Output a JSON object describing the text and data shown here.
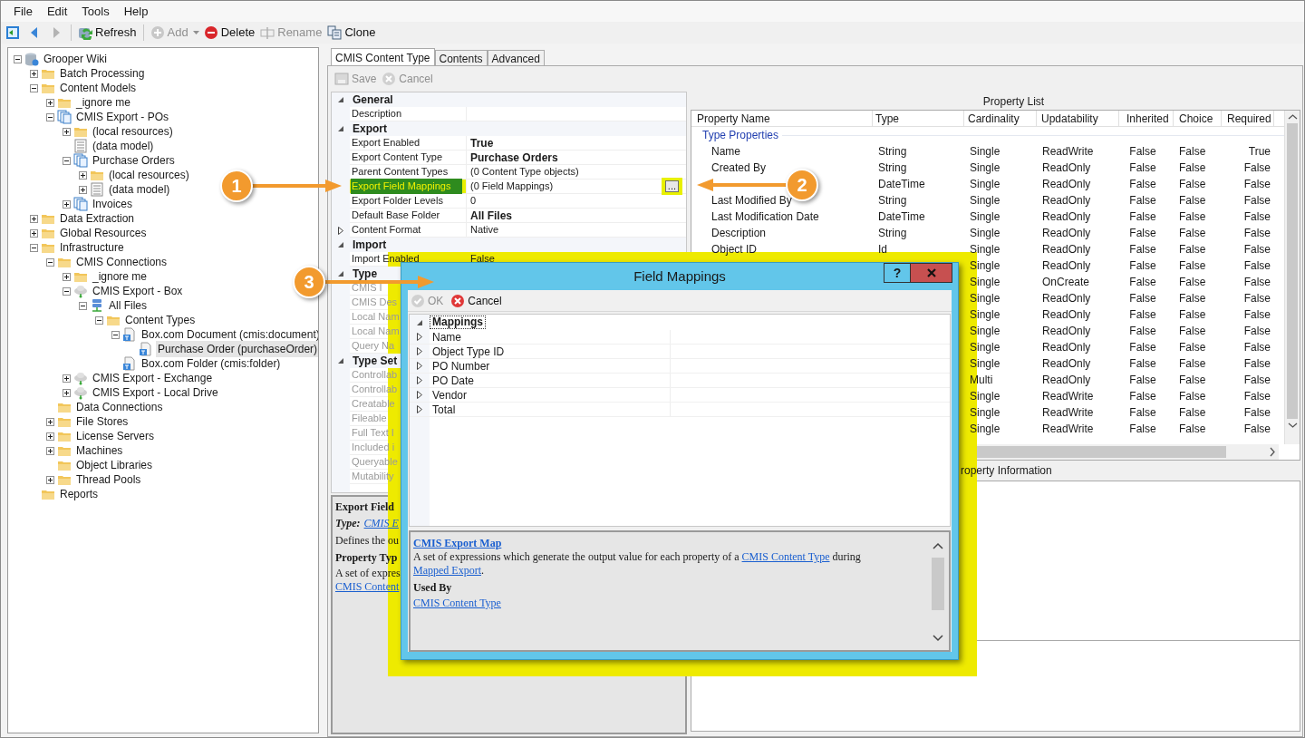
{
  "menu": [
    "File",
    "Edit",
    "Tools",
    "Help"
  ],
  "nav": [
    {
      "kind": "home",
      "disabled": false
    },
    {
      "kind": "back",
      "disabled": false
    },
    {
      "kind": "forward",
      "disabled": true
    }
  ],
  "toolbar": [
    {
      "kind": "refresh",
      "label": "Refresh",
      "disabled": false
    },
    {
      "kind": "add",
      "label": "Add",
      "disabled": true,
      "dropdown": true
    },
    {
      "kind": "delete",
      "label": "Delete",
      "disabled": false
    },
    {
      "kind": "rename",
      "label": "Rename",
      "disabled": true
    },
    {
      "kind": "clone",
      "label": "Clone",
      "disabled": false
    }
  ],
  "tree": [
    {
      "label": "Grooper Wiki",
      "kind": "database",
      "expanded": true,
      "selected": false,
      "children": [
        {
          "label": "Batch Processing",
          "kind": "folder",
          "expanded": false,
          "selected": false
        },
        {
          "label": "Content Models",
          "kind": "folder",
          "expanded": true,
          "selected": false,
          "children": [
            {
              "label": "_ignore me",
              "kind": "folder",
              "expanded": false,
              "selected": false
            },
            {
              "label": "CMIS Export - POs",
              "kind": "docs",
              "expanded": true,
              "selected": false,
              "children": [
                {
                  "label": "(local resources)",
                  "kind": "folder",
                  "expanded": false,
                  "selected": false
                },
                {
                  "label": "(data model)",
                  "kind": "datamodel",
                  "selected": false
                },
                {
                  "label": "Purchase Orders",
                  "kind": "docs",
                  "expanded": true,
                  "selected": false,
                  "children": [
                    {
                      "label": "(local resources)",
                      "kind": "folder",
                      "expanded": false,
                      "selected": false
                    },
                    {
                      "label": "(data model)",
                      "kind": "datamodel",
                      "expanded": false,
                      "selected": false
                    }
                  ]
                },
                {
                  "label": "Invoices",
                  "kind": "docs",
                  "expanded": false,
                  "selected": false
                }
              ]
            }
          ]
        },
        {
          "label": "Data Extraction",
          "kind": "folder",
          "expanded": false,
          "selected": false
        },
        {
          "label": "Global Resources",
          "kind": "folder",
          "expanded": false,
          "selected": false
        },
        {
          "label": "Infrastructure",
          "kind": "folder",
          "expanded": true,
          "selected": false,
          "children": [
            {
              "label": "CMIS Connections",
              "kind": "folder",
              "expanded": true,
              "selected": false,
              "children": [
                {
                  "label": "_ignore me",
                  "kind": "folder",
                  "expanded": false,
                  "selected": false
                },
                {
                  "label": "CMIS Export - Box",
                  "kind": "cloud",
                  "expanded": true,
                  "selected": false,
                  "children": [
                    {
                      "label": "All Files",
                      "kind": "server",
                      "expanded": true,
                      "selected": false,
                      "children": [
                        {
                          "label": "Content Types",
                          "kind": "folder",
                          "expanded": true,
                          "selected": false,
                          "children": [
                            {
                              "label": "Box.com Document (cmis:document)",
                              "kind": "typedoc",
                              "expanded": true,
                              "selected": false,
                              "children": [
                                {
                                  "label": "Purchase Order (purchaseOrder)",
                                  "kind": "typedoc",
                                  "selected": true
                                }
                              ]
                            },
                            {
                              "label": "Box.com Folder (cmis:folder)",
                              "kind": "typedoc",
                              "selected": false
                            }
                          ]
                        }
                      ]
                    }
                  ]
                },
                {
                  "label": "CMIS Export - Exchange",
                  "kind": "cloud",
                  "expanded": false,
                  "selected": false
                },
                {
                  "label": "CMIS Export - Local Drive",
                  "kind": "cloud",
                  "expanded": false,
                  "selected": false
                }
              ]
            },
            {
              "label": "Data Connections",
              "kind": "folder",
              "selected": false
            },
            {
              "label": "File Stores",
              "kind": "folder",
              "expanded": false,
              "selected": false
            },
            {
              "label": "License Servers",
              "kind": "folder",
              "expanded": false,
              "selected": false
            },
            {
              "label": "Machines",
              "kind": "folder",
              "expanded": false,
              "selected": false
            },
            {
              "label": "Object Libraries",
              "kind": "folder",
              "selected": false
            },
            {
              "label": "Thread Pools",
              "kind": "folder",
              "expanded": false,
              "selected": false
            }
          ]
        },
        {
          "label": "Reports",
          "kind": "folder",
          "selected": false
        }
      ]
    }
  ],
  "tabs": [
    {
      "label": "CMIS Content Type",
      "selected": true
    },
    {
      "label": "Contents",
      "selected": false
    },
    {
      "label": "Advanced",
      "selected": false
    }
  ],
  "editor_toolbar": [
    {
      "kind": "save",
      "label": "Save",
      "disabled": true
    },
    {
      "kind": "cancel",
      "label": "Cancel",
      "disabled": true
    }
  ],
  "property_grid": [
    {
      "title": "General",
      "expanded": true,
      "rows": [
        {
          "name": "Description",
          "selected": false
        }
      ]
    },
    {
      "title": "Export",
      "expanded": true,
      "rows": [
        {
          "name": "Export Enabled",
          "value": "True",
          "bold": true,
          "selected": false
        },
        {
          "name": "Export Content Type",
          "value": "Purchase Orders",
          "bold": true,
          "selected": false
        },
        {
          "name": "Parent Content Types",
          "value": "(0 Content Type objects)",
          "selected": false
        },
        {
          "name": "Export Field Mappings",
          "value": "(0 Field Mappings)",
          "selected": true,
          "button": "..."
        },
        {
          "name": "Export Folder Levels",
          "value": "0",
          "selected": false
        },
        {
          "name": "Default Base Folder",
          "value": "All Files",
          "bold": true,
          "selected": false
        },
        {
          "name": "Content Format",
          "value": "Native",
          "expanded": false,
          "selected": false
        }
      ]
    },
    {
      "title": "Import",
      "expanded": true,
      "rows": [
        {
          "name": "Import Enabled",
          "value": "False",
          "selected": false
        }
      ]
    },
    {
      "title": "Type",
      "expanded": true,
      "rows": [
        {
          "name": "CMIS I",
          "disabled": true,
          "selected": false
        },
        {
          "name": "CMIS Des",
          "disabled": true,
          "selected": false
        },
        {
          "name": "Local Nam",
          "disabled": true,
          "selected": false
        },
        {
          "name": "Local Nam",
          "disabled": true,
          "selected": false
        },
        {
          "name": "Query Na",
          "disabled": true,
          "selected": false
        }
      ]
    },
    {
      "title": "Type Set",
      "expanded": true,
      "rows": [
        {
          "name": "Controllab",
          "disabled": true,
          "selected": false
        },
        {
          "name": "Controllab",
          "disabled": true,
          "selected": false
        },
        {
          "name": "Creatable",
          "disabled": true,
          "selected": false
        },
        {
          "name": "Fileable",
          "disabled": true,
          "selected": false
        },
        {
          "name": "Full Text I",
          "disabled": true,
          "selected": false
        },
        {
          "name": "Included i",
          "disabled": true,
          "selected": false
        },
        {
          "name": "Queryable",
          "disabled": true,
          "selected": false
        },
        {
          "name": "Mutability",
          "disabled": true,
          "selected": false
        }
      ]
    }
  ],
  "help": {
    "title": "Export Field",
    "type_label": "Type:",
    "type_link": "CMIS E",
    "text": "Defines the ou",
    "heading": "Property Typ",
    "text2": "A set of expres",
    "link": "CMIS Content"
  },
  "property_list": {
    "title": "Property List",
    "columns": [
      "Property Name",
      "Type",
      "Cardinality",
      "Updatability",
      "Inherited",
      "Choice",
      "Required"
    ],
    "group": "Type Properties",
    "rows": [
      {
        "name": "Name",
        "type": "String",
        "cardinality": "Single",
        "updatability": "ReadWrite",
        "inherited": "False",
        "choice": "False",
        "required": "True"
      },
      {
        "name": "Created By",
        "type": "String",
        "cardinality": "Single",
        "updatability": "ReadOnly",
        "inherited": "False",
        "choice": "False",
        "required": "False"
      },
      {
        "type": "DateTime",
        "cardinality": "Single",
        "updatability": "ReadOnly",
        "inherited": "False",
        "choice": "False",
        "required": "False"
      },
      {
        "name": "Last Modified By",
        "type": "String",
        "cardinality": "Single",
        "updatability": "ReadOnly",
        "inherited": "False",
        "choice": "False",
        "required": "False"
      },
      {
        "name": "Last Modification Date",
        "type": "DateTime",
        "cardinality": "Single",
        "updatability": "ReadOnly",
        "inherited": "False",
        "choice": "False",
        "required": "False"
      },
      {
        "name": "Description",
        "type": "String",
        "cardinality": "Single",
        "updatability": "ReadOnly",
        "inherited": "False",
        "choice": "False",
        "required": "False"
      },
      {
        "name": "Object ID",
        "type": "Id",
        "cardinality": "Single",
        "updatability": "ReadOnly",
        "inherited": "False",
        "choice": "False",
        "required": "False"
      },
      {
        "cardinality": "Single",
        "updatability": "ReadOnly",
        "inherited": "False",
        "choice": "False",
        "required": "False"
      },
      {
        "cardinality": "Single",
        "updatability": "OnCreate",
        "inherited": "False",
        "choice": "False",
        "required": "False"
      },
      {
        "cardinality": "Single",
        "updatability": "ReadOnly",
        "inherited": "False",
        "choice": "False",
        "required": "False"
      },
      {
        "cardinality": "Single",
        "updatability": "ReadOnly",
        "inherited": "False",
        "choice": "False",
        "required": "False"
      },
      {
        "cardinality": "Single",
        "updatability": "ReadOnly",
        "inherited": "False",
        "choice": "False",
        "required": "False"
      },
      {
        "cardinality": "Single",
        "updatability": "ReadOnly",
        "inherited": "False",
        "choice": "False",
        "required": "False"
      },
      {
        "cardinality": "Single",
        "updatability": "ReadOnly",
        "inherited": "False",
        "choice": "False",
        "required": "False"
      },
      {
        "cardinality": "Multi",
        "updatability": "ReadOnly",
        "inherited": "False",
        "choice": "False",
        "required": "False"
      },
      {
        "cardinality": "Single",
        "updatability": "ReadWrite",
        "inherited": "False",
        "choice": "False",
        "required": "False"
      },
      {
        "cardinality": "Single",
        "updatability": "ReadWrite",
        "inherited": "False",
        "choice": "False",
        "required": "False"
      },
      {
        "cardinality": "Single",
        "updatability": "ReadWrite",
        "inherited": "False",
        "choice": "False",
        "required": "False"
      }
    ]
  },
  "property_info": {
    "title": "roperty Information"
  },
  "dialog": {
    "title": "Field Mappings",
    "help_button": "?",
    "toolbar": [
      {
        "kind": "ok",
        "label": "OK",
        "disabled": true
      },
      {
        "kind": "cancel",
        "label": "Cancel",
        "disabled": false
      }
    ],
    "section": {
      "title": "Mappings",
      "expanded": true,
      "rows": [
        {
          "name": "Name",
          "expanded": false
        },
        {
          "name": "Object Type ID",
          "expanded": false
        },
        {
          "name": "PO Number",
          "expanded": false
        },
        {
          "name": "PO Date",
          "expanded": false
        },
        {
          "name": "Vendor",
          "expanded": false
        },
        {
          "name": "Total",
          "expanded": false
        }
      ]
    },
    "help": {
      "title": "CMIS Export Map",
      "description": [
        {
          "text": "A set of expressions which generate the output value for each property of a "
        },
        {
          "link": "CMIS Content Type"
        },
        {
          "text": " during "
        },
        {
          "link": "Mapped Export"
        },
        {
          "text": "."
        }
      ],
      "heading": "Used By",
      "link": "CMIS Content Type"
    }
  },
  "callouts": [
    {
      "label": "1"
    },
    {
      "label": "2"
    },
    {
      "label": "3"
    }
  ]
}
